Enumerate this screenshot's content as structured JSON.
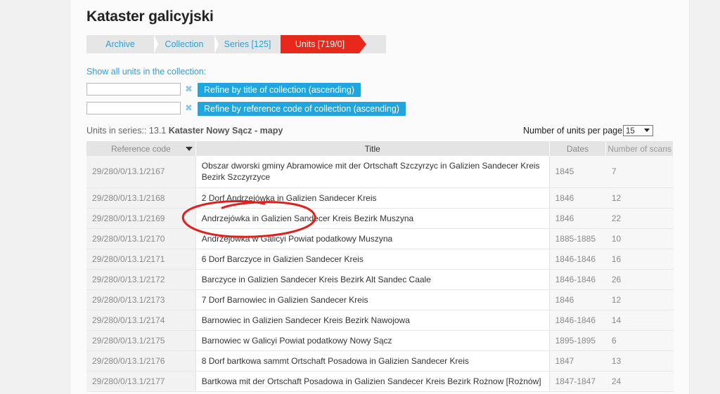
{
  "page": {
    "title": "Kataster galicyjski"
  },
  "breadcrumb": {
    "archive": "Archive",
    "collection": "Collection",
    "series": "Series [125]",
    "units": "Units [719/0]"
  },
  "show_all_label": "Show all units in the collection:",
  "filters": {
    "title_button": "Refine by title of collection (ascending)",
    "refcode_button": "Refine by reference code of collection (ascending)",
    "clear_symbol": "✖"
  },
  "series_info": {
    "prefix": "Units in series:: 13.1 ",
    "name": "Kataster Nowy Sącz - mapy"
  },
  "per_page": {
    "label": "Number of units per page",
    "value": "15"
  },
  "table": {
    "headers": {
      "ref": "Reference code",
      "title": "Title",
      "dates": "Dates",
      "scans": "Number of scans"
    },
    "rows": [
      {
        "ref": "29/280/0/13.1/2167",
        "title": "Obszar dworski gminy Abramowice mit der Ortschaft Szczyrzyc in Galizien Sandecer Kreis Bezirk Szczyrzyce",
        "dates": "1845",
        "scans": "7"
      },
      {
        "ref": "29/280/0/13.1/2168",
        "title": "2 Dorf Andrzejówka in Galizien Sandecer Kreis",
        "dates": "1846",
        "scans": "12"
      },
      {
        "ref": "29/280/0/13.1/2169",
        "title": "Andrzejówka in Galizien Sandecer Kreis Bezirk Muszyna",
        "dates": "1846",
        "scans": "22"
      },
      {
        "ref": "29/280/0/13.1/2170",
        "title": "Andrzejówka w Galicyi Powiat podatkowy Muszyna",
        "dates": "1885-1885",
        "scans": "10"
      },
      {
        "ref": "29/280/0/13.1/2171",
        "title": "6 Dorf Barczyce in Galizien Sandecer Kreis",
        "dates": "1846-1846",
        "scans": "16"
      },
      {
        "ref": "29/280/0/13.1/2172",
        "title": "Barczyce in Galizien Sandecer Kreis Bezirk Alt Sandec Caale",
        "dates": "1846-1846",
        "scans": "26"
      },
      {
        "ref": "29/280/0/13.1/2173",
        "title": "7 Dorf Barnowiec in Galizien Sandecer Kreis",
        "dates": "1846",
        "scans": "12"
      },
      {
        "ref": "29/280/0/13.1/2174",
        "title": "Barnowiec in Galizien Sandecer Kreis Bezirk Nawojowa",
        "dates": "1846-1846",
        "scans": "14"
      },
      {
        "ref": "29/280/0/13.1/2175",
        "title": "Barnowiec w Galicyi Powiat podatkowy Nowy Sącz",
        "dates": "1895-1895",
        "scans": "6"
      },
      {
        "ref": "29/280/0/13.1/2176",
        "title": "8 Dorf bartkowa sammt Ortschaft Posadowa in Galizien Sandecer Kreis",
        "dates": "1847",
        "scans": "13"
      },
      {
        "ref": "29/280/0/13.1/2177",
        "title": "Bartkowa mit der Ortschaft Posadowa in Galizien Sandecer Kreis Bezirk Rożnow [Rożnów]",
        "dates": "1847-1847",
        "scans": "24"
      }
    ]
  },
  "colors": {
    "accent": "#2aa1d8",
    "active": "#e8281a",
    "button": "#1fa6e0",
    "annotation": "#e0201c"
  }
}
